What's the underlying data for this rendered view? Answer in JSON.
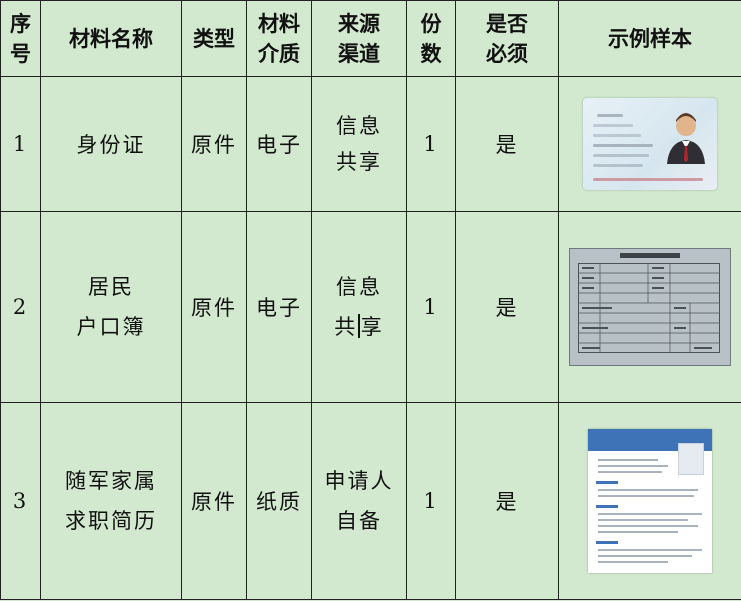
{
  "headers": {
    "seq": [
      "序",
      "号"
    ],
    "name": "材料名称",
    "type": "类型",
    "medium": [
      "材料",
      "介质"
    ],
    "source": [
      "来源",
      "渠道"
    ],
    "copies": [
      "份",
      "数"
    ],
    "required": [
      "是否",
      "必须"
    ],
    "sample": "示例样本"
  },
  "rows": [
    {
      "seq": "1",
      "name": [
        "身份证"
      ],
      "type": "原件",
      "medium": "电子",
      "source": [
        "信息",
        "共享"
      ],
      "copies": "1",
      "required": "是",
      "sample_icon": "id-card-image"
    },
    {
      "seq": "2",
      "name": [
        "居民",
        "户口簿"
      ],
      "type": "原件",
      "medium": "电子",
      "source": [
        "信息",
        "共",
        "享"
      ],
      "copies": "1",
      "required": "是",
      "sample_icon": "household-register-image"
    },
    {
      "seq": "3",
      "name": [
        "随军家属",
        "求职简历"
      ],
      "type": "原件",
      "medium": "纸质",
      "source": [
        "申请人",
        "自备"
      ],
      "copies": "1",
      "required": "是",
      "sample_icon": "resume-image"
    }
  ]
}
